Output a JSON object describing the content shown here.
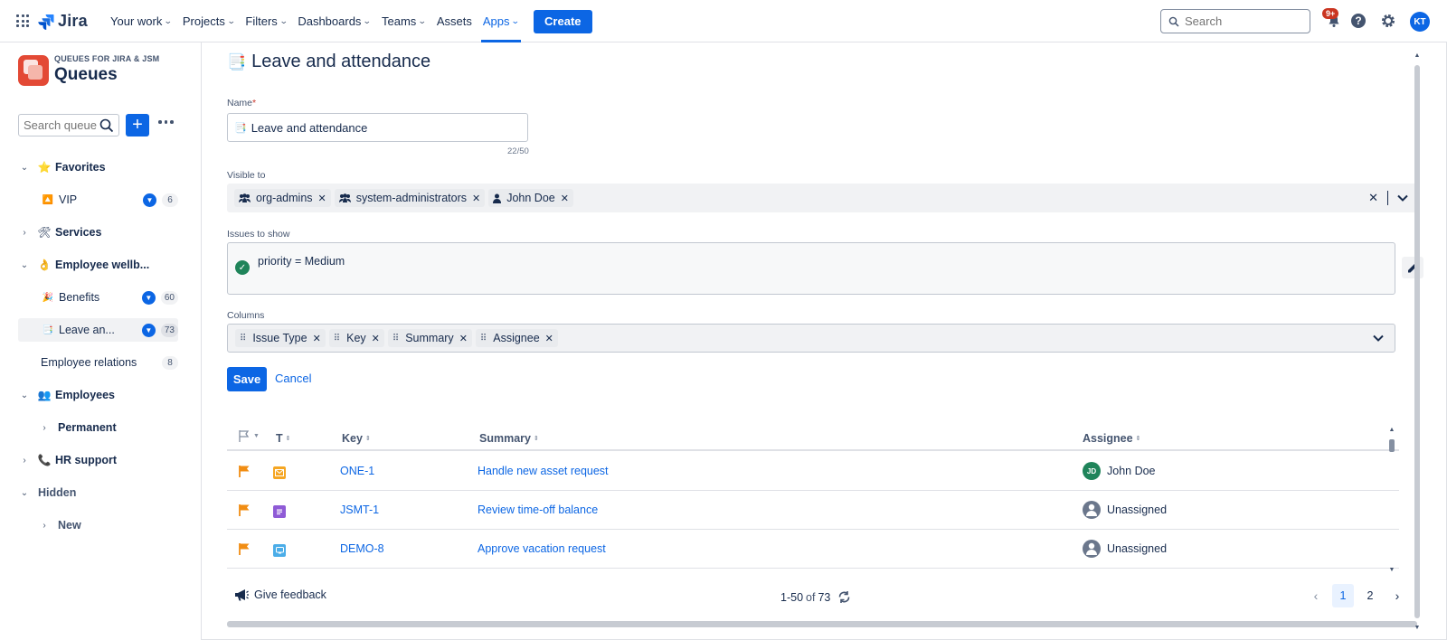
{
  "topnav": {
    "logo_text": "Jira",
    "items": [
      {
        "label": "Your work",
        "chevron": true
      },
      {
        "label": "Projects",
        "chevron": true
      },
      {
        "label": "Filters",
        "chevron": true
      },
      {
        "label": "Dashboards",
        "chevron": true
      },
      {
        "label": "Teams",
        "chevron": true
      },
      {
        "label": "Assets",
        "chevron": false
      },
      {
        "label": "Apps",
        "chevron": true,
        "active": true
      }
    ],
    "create_label": "Create",
    "search_placeholder": "Search",
    "notifications_badge": "9+",
    "user_initials": "KT"
  },
  "sidebar": {
    "app_caption": "QUEUES FOR JIRA & JSM",
    "app_title": "Queues",
    "search_placeholder": "Search queue",
    "tree": [
      {
        "label": "Favorites",
        "toggle": "⌄",
        "icon": "⭐",
        "bold": true
      },
      {
        "label": "VIP",
        "icon": "🔼",
        "filter": true,
        "count": "6"
      },
      {
        "label": "Services",
        "toggle": "›",
        "icon": "🛠",
        "bold": true
      },
      {
        "label": "Employee wellb...",
        "toggle": "⌄",
        "icon": "👌",
        "bold": true
      },
      {
        "label": "Benefits",
        "icon": "🎉",
        "filter": true,
        "count": "60"
      },
      {
        "label": "Leave an...",
        "icon": "📑",
        "filter": true,
        "count": "73",
        "selected": true
      },
      {
        "label": "Employee relations",
        "count": "8"
      },
      {
        "label": "Employees",
        "toggle": "⌄",
        "icon": "👥",
        "bold": true
      },
      {
        "label": "Permanent",
        "toggle": "›",
        "bold": true
      },
      {
        "label": "HR support",
        "toggle": "›",
        "icon": "📞",
        "bold": true
      },
      {
        "label": "Hidden",
        "toggle": "⌄",
        "bold": true
      },
      {
        "label": "New",
        "toggle": "›",
        "bold": true
      }
    ]
  },
  "main": {
    "title": "Leave and attendance",
    "title_icon": "📑",
    "name_label": "Name",
    "name_required": "*",
    "name_value": "Leave and attendance",
    "name_count": "22/50",
    "visible_label": "Visible to",
    "visible_chips": [
      {
        "label": "org-admins",
        "icon": "group"
      },
      {
        "label": "system-administrators",
        "icon": "group"
      },
      {
        "label": "John Doe",
        "icon": "person"
      }
    ],
    "issues_label": "Issues to show",
    "jql": "priority = Medium",
    "columns_label": "Columns",
    "column_chips": [
      "Issue Type",
      "Key",
      "Summary",
      "Assignee"
    ],
    "save_label": "Save",
    "cancel_label": "Cancel"
  },
  "table": {
    "headers": {
      "t": "T",
      "key": "Key",
      "summary": "Summary",
      "assignee": "Assignee"
    },
    "rows": [
      {
        "key": "ONE-1",
        "summary": "Handle new asset request",
        "assignee": "John Doe",
        "assignee_initials": "JD",
        "assignee_color": "#1f845a",
        "type_color": "#f5a623",
        "type_icon": "envelope-icon"
      },
      {
        "key": "JSMT-1",
        "summary": "Review time-off balance",
        "assignee": "Unassigned",
        "type_color": "#8f5bd6",
        "type_icon": "story-icon"
      },
      {
        "key": "DEMO-8",
        "summary": "Approve vacation request",
        "assignee": "Unassigned",
        "type_color": "#4bade8",
        "type_icon": "screen-icon"
      }
    ]
  },
  "footer": {
    "feedback_label": "Give feedback",
    "range": "1-50",
    "of_word": "of",
    "total": "73",
    "pages": [
      "1",
      "2"
    ],
    "current_page": "1"
  },
  "colors": {
    "accent": "#0c66e4",
    "flag": "#f18d13"
  }
}
